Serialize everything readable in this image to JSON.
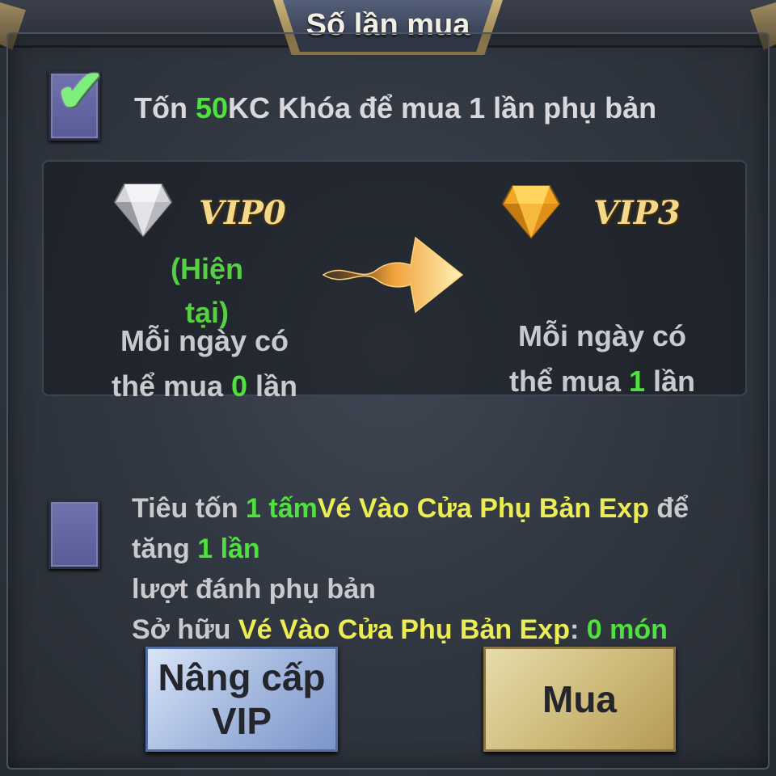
{
  "dialog": {
    "title": "Số lần mua"
  },
  "option1": {
    "checked": true,
    "text_prefix": "Tốn ",
    "amount": "50",
    "text_suffix": "KC Khóa để mua 1 lần phụ bản"
  },
  "comparison": {
    "current": {
      "vip_label": "VIP0",
      "current_tag": "(Hiện tại)",
      "desc_prefix": "Mỗi ngày có thể mua ",
      "count": "0",
      "desc_suffix": " lần",
      "gem_color": "#c8c8cc"
    },
    "next": {
      "vip_label": "VIP3",
      "desc_prefix": "Mỗi ngày có thể mua ",
      "count": "1",
      "desc_suffix": " lần",
      "gem_color": "#f2a623"
    },
    "arrow_icon": "flaming-arrow-icon"
  },
  "option2": {
    "checked": false,
    "line1_prefix": "Tiêu tốn ",
    "line1_qty": "1 tấm",
    "line1_item": "Vé Vào Cửa Phụ Bản Exp",
    "line1_mid": " để tăng ",
    "line1_count": "1 lần",
    "line2": "lượt đánh phụ bản",
    "line3_prefix": "Sở hữu ",
    "line3_item": "Vé Vào Cửa Phụ Bản Exp",
    "line3_colon": ": ",
    "line3_count": "0 món"
  },
  "buttons": {
    "upgrade_vip": "Nâng cấp VIP",
    "buy": "Mua"
  },
  "colors": {
    "highlight_green": "#4fe13d",
    "highlight_yellow": "#ecec53",
    "vip_gold": "#f4d98a"
  }
}
